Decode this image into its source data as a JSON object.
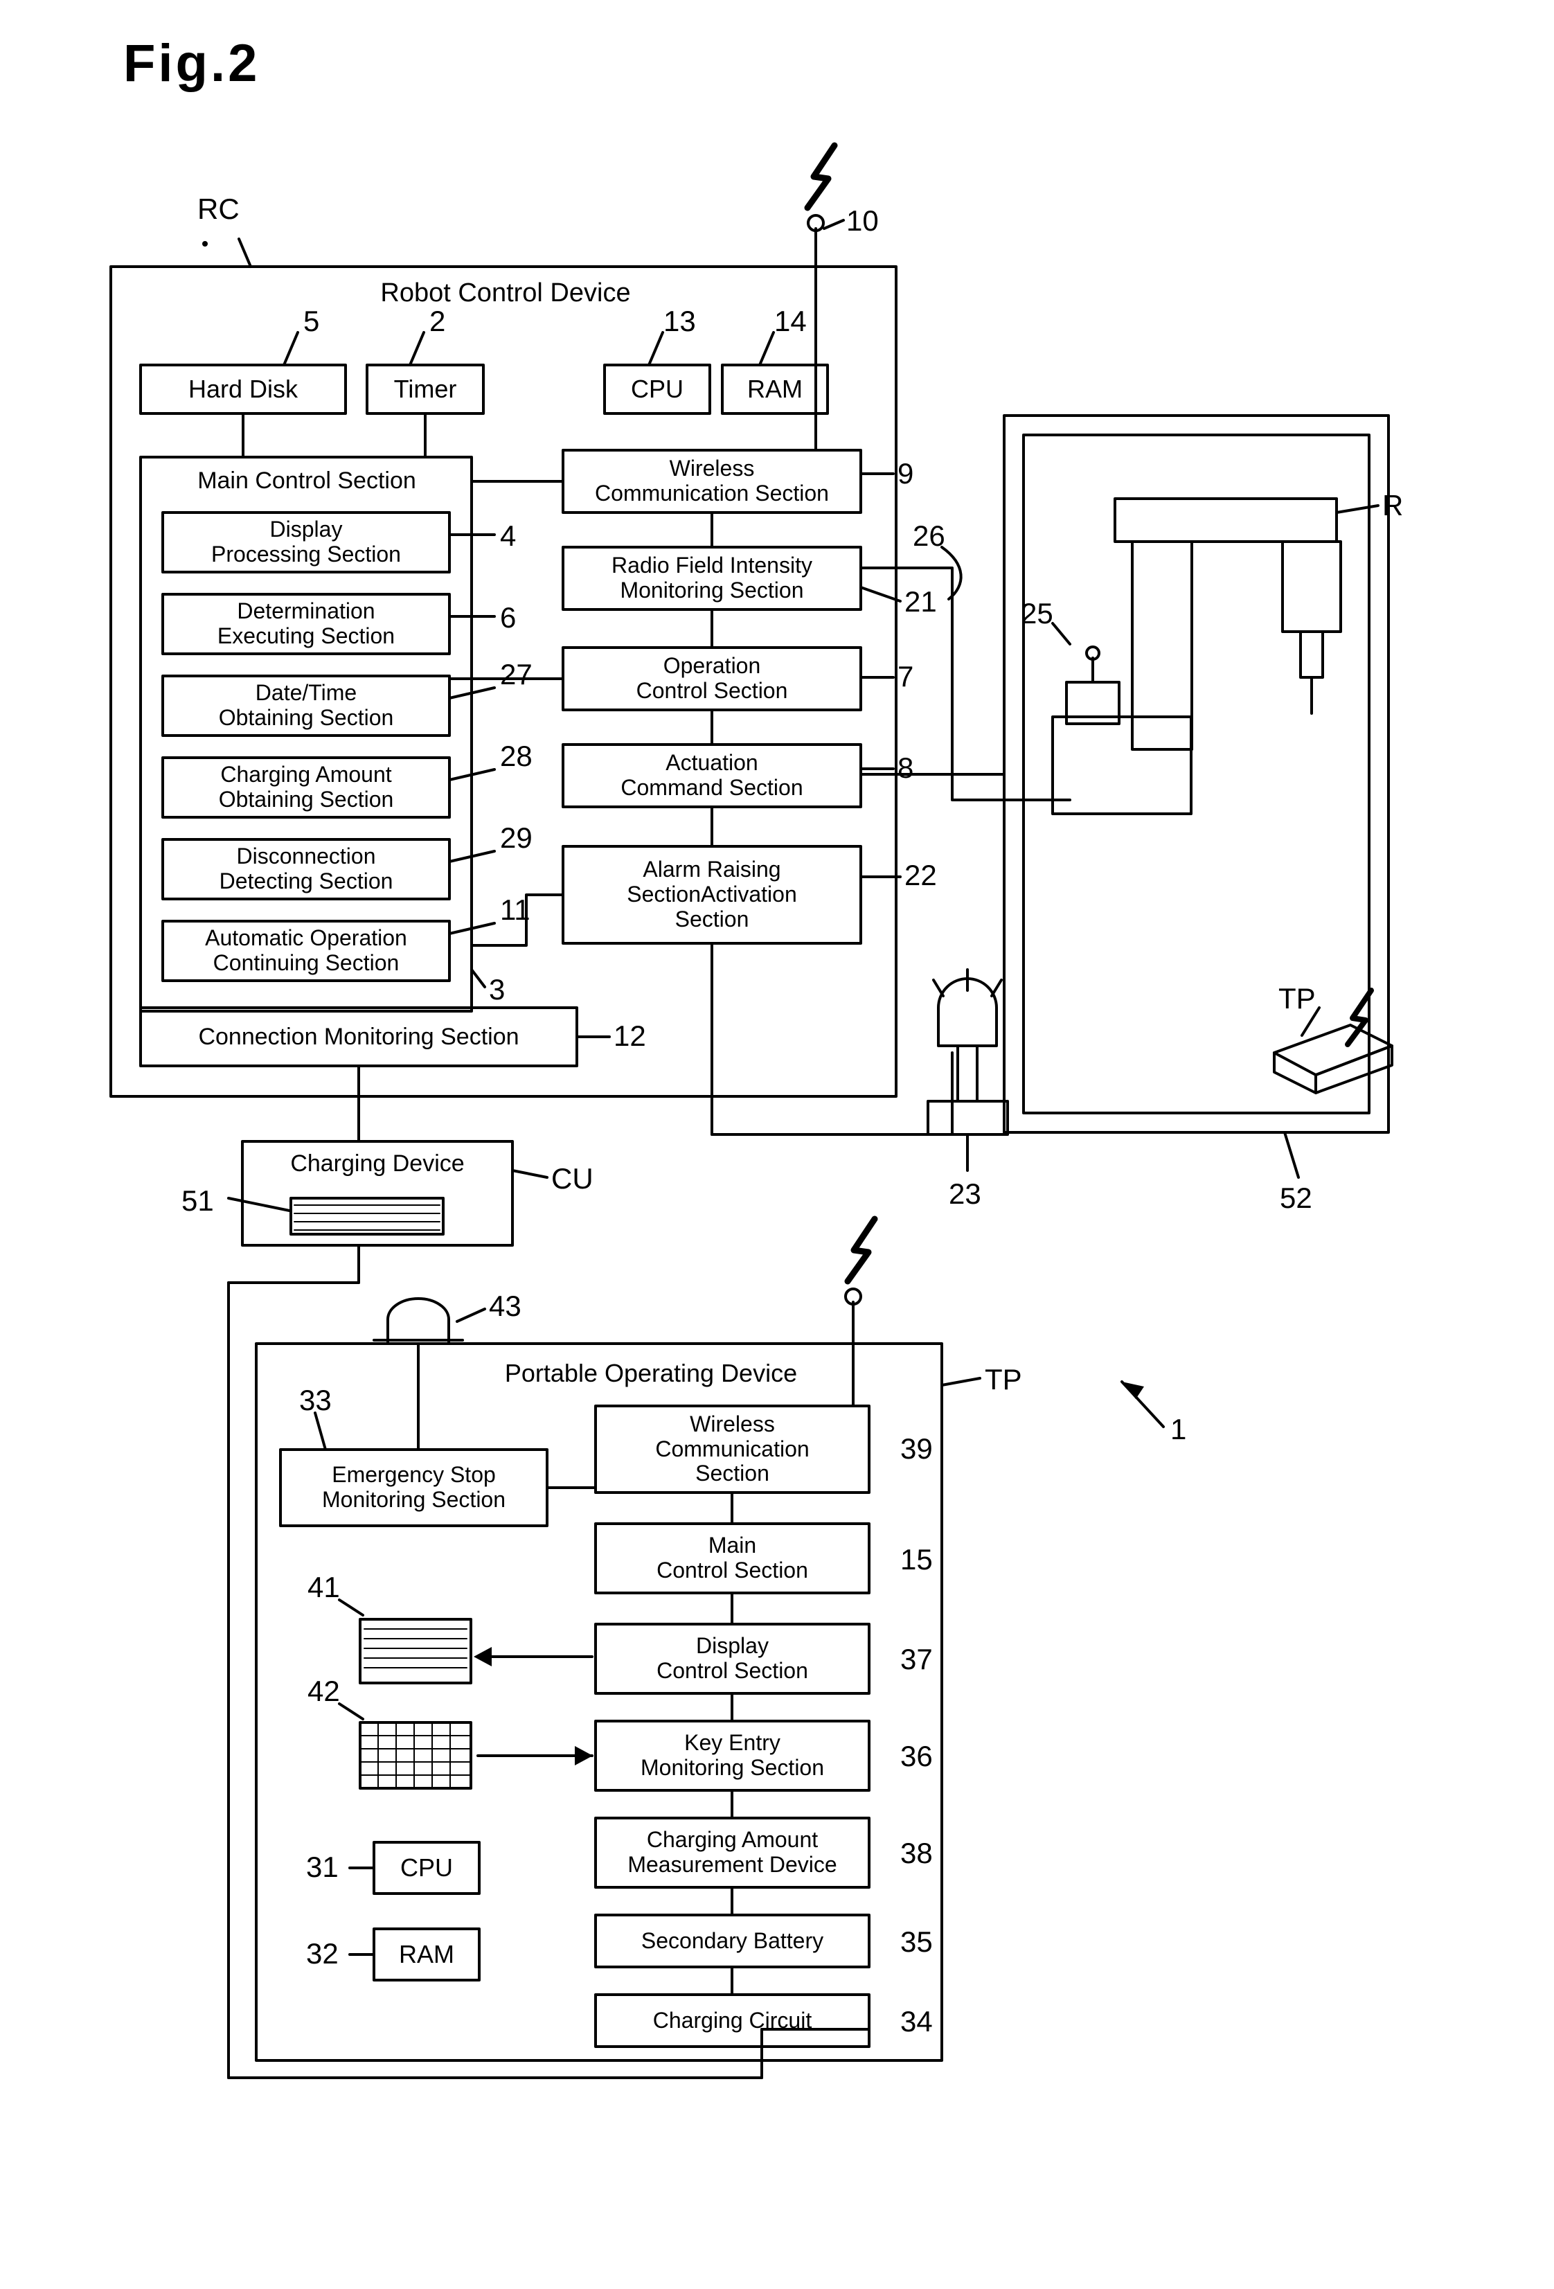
{
  "figure": {
    "title": "Fig.2",
    "diagram_type": "block-diagram",
    "description": "Robot control system block diagram with robot control device, charging device, portable operating device and robot cell"
  },
  "robot_control_device": {
    "title": "Robot Control Device",
    "ref": "RC",
    "antenna_ref": "10",
    "top_boxes": [
      {
        "label": "Hard Disk",
        "ref": "5"
      },
      {
        "label": "Timer",
        "ref": "2"
      },
      {
        "label": "CPU",
        "ref": "13"
      },
      {
        "label": "RAM",
        "ref": "14"
      }
    ],
    "main_control_section": {
      "label": "Main Control Section",
      "ref": "3",
      "subsections": [
        {
          "label": "Display\nProcessing Section",
          "ref": "4"
        },
        {
          "label": "Determination\nExecuting Section",
          "ref": "6"
        },
        {
          "label": "Date/Time\nObtaining Section",
          "ref": "27"
        },
        {
          "label": "Charging Amount\nObtaining Section",
          "ref": "28"
        },
        {
          "label": "Disconnection\nDetecting Section",
          "ref": "29"
        },
        {
          "label": "Automatic Operation\nContinuing Section",
          "ref": "11"
        }
      ]
    },
    "right_boxes": [
      {
        "label": "Wireless\nCommunication Section",
        "ref": "9"
      },
      {
        "label": "Radio Field Intensity\nMonitoring Section",
        "ref": "21"
      },
      {
        "label": "Operation\nControl Section",
        "ref": "7"
      },
      {
        "label": "Actuation\nCommand Section",
        "ref": "8"
      },
      {
        "label": "Alarm Raising\nSectionActivation\nSection",
        "ref": "22"
      }
    ],
    "connection_monitoring": {
      "label": "Connection Monitoring Section",
      "ref": "12"
    },
    "line_ref_26": "26"
  },
  "charging_device": {
    "label": "Charging Device",
    "ref": "CU",
    "battery_ref": "51"
  },
  "portable_operating_device": {
    "title": "Portable Operating Device",
    "ref": "TP",
    "antenna_label": "43",
    "emergency_stop": {
      "label": "Emergency Stop\nMonitoring Section",
      "ref": "33"
    },
    "right_column": [
      {
        "label": "Wireless\nCommunication\nSection",
        "ref": "39"
      },
      {
        "label": "Main\nControl Section",
        "ref": "15"
      },
      {
        "label": "Display\nControl Section",
        "ref": "37"
      },
      {
        "label": "Key Entry\nMonitoring Section",
        "ref": "36"
      },
      {
        "label": "Charging Amount\nMeasurement Device",
        "ref": "38"
      },
      {
        "label": "Secondary Battery",
        "ref": "35"
      },
      {
        "label": "Charging Circuit",
        "ref": "34"
      }
    ],
    "display_ref": "41",
    "keypad_ref": "42",
    "cpu": {
      "label": "CPU",
      "ref": "31"
    },
    "ram": {
      "label": "RAM",
      "ref": "32"
    }
  },
  "robot_cell": {
    "robot_ref": "R",
    "controller_ref": "25",
    "cell_ref": "52",
    "signal_tower_ref": "23",
    "teach_pendant_ref": "TP"
  },
  "system_ref": "1"
}
